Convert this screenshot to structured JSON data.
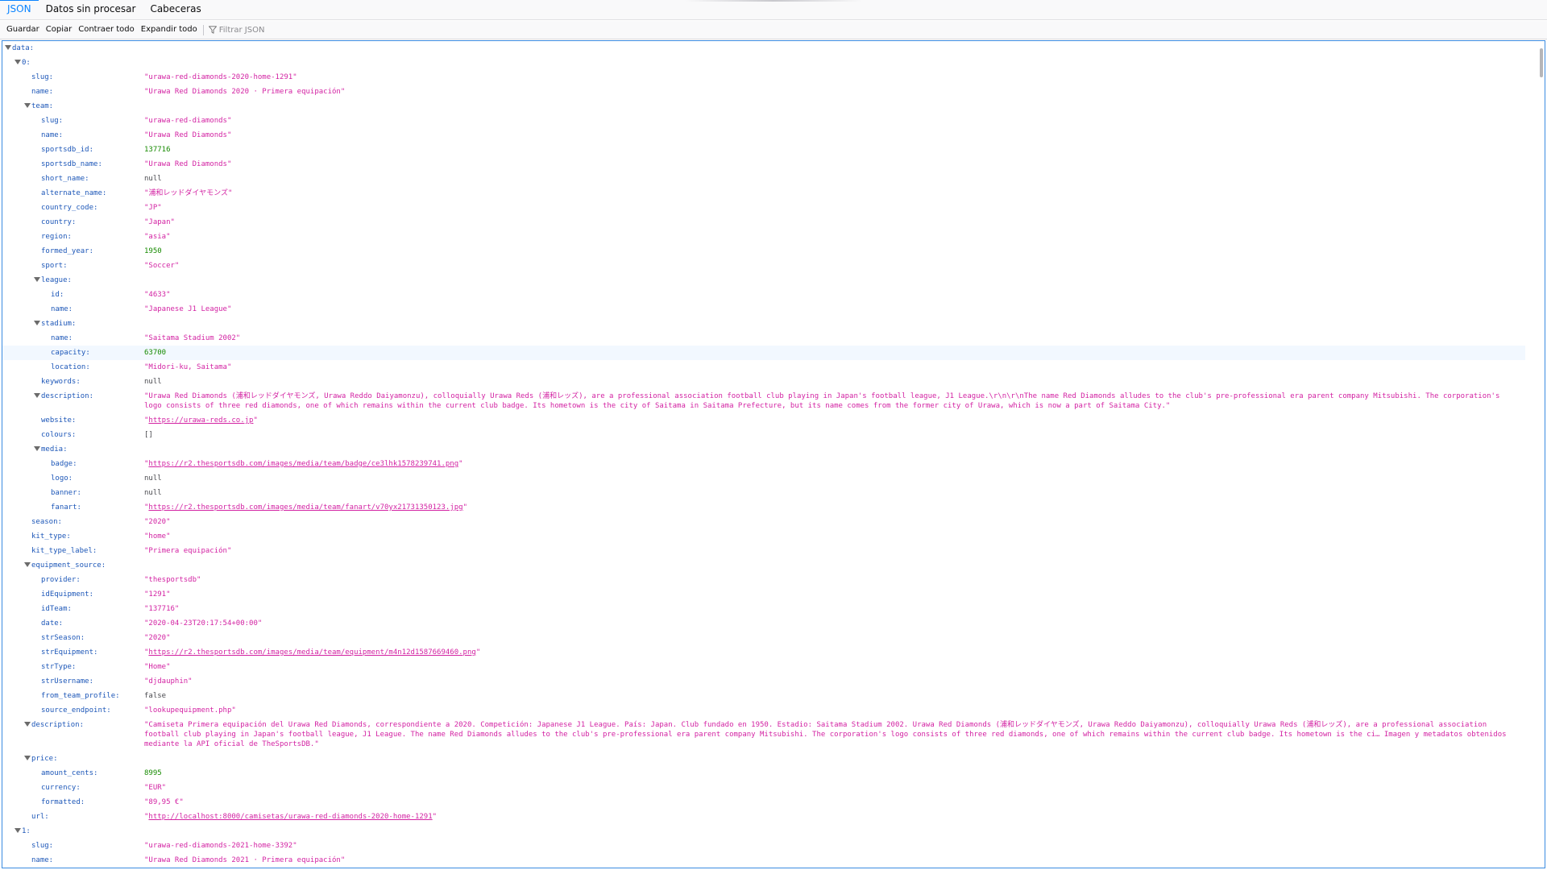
{
  "tabs": [
    {
      "label": "JSON"
    },
    {
      "label": "Datos sin procesar"
    },
    {
      "label": "Cabeceras"
    }
  ],
  "toolbar": {
    "save_label": "Guardar",
    "copy_label": "Copiar",
    "collapse_label": "Contraer todo",
    "expand_label": "Expandir todo",
    "filter_placeholder": "Filtrar JSON"
  },
  "icons": {
    "twisty": "expanded-triangle-icon",
    "filter": "funnel-icon"
  },
  "colors": {
    "accent": "#0a84ff",
    "key": "#1d57b8",
    "string": "#d323a3",
    "number": "#168a00",
    "highlight_row": "#f2f8ff"
  },
  "rows": [
    {
      "depth": 0,
      "toggle": true,
      "key": "data:",
      "type": "obj"
    },
    {
      "depth": 1,
      "toggle": true,
      "key": "0:",
      "type": "obj"
    },
    {
      "depth": 2,
      "key": "slug:",
      "value": "\"urawa-red-diamonds-2020-home-1291\"",
      "type": "str"
    },
    {
      "depth": 2,
      "key": "name:",
      "value": "\"Urawa Red Diamonds 2020 · Primera equipación\"",
      "type": "str"
    },
    {
      "depth": 2,
      "toggle": true,
      "key": "team:",
      "type": "obj"
    },
    {
      "depth": 3,
      "key": "slug:",
      "value": "\"urawa-red-diamonds\"",
      "type": "str"
    },
    {
      "depth": 3,
      "key": "name:",
      "value": "\"Urawa Red Diamonds\"",
      "type": "str"
    },
    {
      "depth": 3,
      "key": "sportsdb_id:",
      "value": "137716",
      "type": "num"
    },
    {
      "depth": 3,
      "key": "sportsdb_name:",
      "value": "\"Urawa Red Diamonds\"",
      "type": "str"
    },
    {
      "depth": 3,
      "key": "short_name:",
      "value": "null",
      "type": "nul"
    },
    {
      "depth": 3,
      "key": "alternate_name:",
      "value": "\"浦和レッドダイヤモンズ\"",
      "type": "str"
    },
    {
      "depth": 3,
      "key": "country_code:",
      "value": "\"JP\"",
      "type": "str"
    },
    {
      "depth": 3,
      "key": "country:",
      "value": "\"Japan\"",
      "type": "str"
    },
    {
      "depth": 3,
      "key": "region:",
      "value": "\"asia\"",
      "type": "str"
    },
    {
      "depth": 3,
      "key": "formed_year:",
      "value": "1950",
      "type": "num"
    },
    {
      "depth": 3,
      "key": "sport:",
      "value": "\"Soccer\"",
      "type": "str"
    },
    {
      "depth": 3,
      "toggle": true,
      "key": "league:",
      "type": "obj"
    },
    {
      "depth": 4,
      "key": "id:",
      "value": "\"4633\"",
      "type": "str"
    },
    {
      "depth": 4,
      "key": "name:",
      "value": "\"Japanese J1 League\"",
      "type": "str"
    },
    {
      "depth": 3,
      "toggle": true,
      "key": "stadium:",
      "type": "obj"
    },
    {
      "depth": 4,
      "key": "name:",
      "value": "\"Saitama Stadium 2002\"",
      "type": "str"
    },
    {
      "depth": 4,
      "key": "capacity:",
      "value": "63700",
      "type": "num",
      "highlight": true
    },
    {
      "depth": 4,
      "key": "location:",
      "value": "\"Midori-ku, Saitama\"",
      "type": "str"
    },
    {
      "depth": 3,
      "key": "keywords:",
      "value": "null",
      "type": "nul"
    },
    {
      "depth": 3,
      "toggle": true,
      "key": "description:",
      "value": "\"Urawa Red Diamonds (浦和レッドダイヤモンズ, Urawa Reddo Daiyamonzu), colloquially Urawa Reds (浦和レッズ), are a professional association football club playing in Japan's football league, J1 League.\\r\\n\\r\\nThe name Red Diamonds alludes to the club's pre-professional era parent company Mitsubishi. The corporation's logo consists of three red diamonds, one of which remains within the current club badge. Its hometown is the city of Saitama in Saitama Prefecture, but its name comes from the former city of Urawa, which is now a part of Saitama City.\"",
      "type": "str",
      "lines": 2
    },
    {
      "depth": 3,
      "key": "website:",
      "value": "https://urawa-reds.co.jp",
      "type": "link"
    },
    {
      "depth": 3,
      "key": "colours:",
      "value": "[]",
      "type": "arr"
    },
    {
      "depth": 3,
      "toggle": true,
      "key": "media:",
      "type": "obj"
    },
    {
      "depth": 4,
      "key": "badge:",
      "value": "https://r2.thesportsdb.com/images/media/team/badge/ce3lhk1578239741.png",
      "type": "link"
    },
    {
      "depth": 4,
      "key": "logo:",
      "value": "null",
      "type": "nul"
    },
    {
      "depth": 4,
      "key": "banner:",
      "value": "null",
      "type": "nul"
    },
    {
      "depth": 4,
      "key": "fanart:",
      "value": "https://r2.thesportsdb.com/images/media/team/fanart/v70yx21731350123.jpg",
      "type": "link"
    },
    {
      "depth": 2,
      "key": "season:",
      "value": "\"2020\"",
      "type": "str"
    },
    {
      "depth": 2,
      "key": "kit_type:",
      "value": "\"home\"",
      "type": "str"
    },
    {
      "depth": 2,
      "key": "kit_type_label:",
      "value": "\"Primera equipación\"",
      "type": "str"
    },
    {
      "depth": 2,
      "toggle": true,
      "key": "equipment_source:",
      "type": "obj"
    },
    {
      "depth": 3,
      "key": "provider:",
      "value": "\"thesportsdb\"",
      "type": "str"
    },
    {
      "depth": 3,
      "key": "idEquipment:",
      "value": "\"1291\"",
      "type": "str"
    },
    {
      "depth": 3,
      "key": "idTeam:",
      "value": "\"137716\"",
      "type": "str"
    },
    {
      "depth": 3,
      "key": "date:",
      "value": "\"2020-04-23T20:17:54+00:00\"",
      "type": "str"
    },
    {
      "depth": 3,
      "key": "strSeason:",
      "value": "\"2020\"",
      "type": "str"
    },
    {
      "depth": 3,
      "key": "strEquipment:",
      "value": "https://r2.thesportsdb.com/images/media/team/equipment/m4n12d1587669460.png",
      "type": "link"
    },
    {
      "depth": 3,
      "key": "strType:",
      "value": "\"Home\"",
      "type": "str"
    },
    {
      "depth": 3,
      "key": "strUsername:",
      "value": "\"djdauphin\"",
      "type": "str"
    },
    {
      "depth": 3,
      "key": "from_team_profile:",
      "value": "false",
      "type": "bool"
    },
    {
      "depth": 3,
      "key": "source_endpoint:",
      "value": "\"lookupequipment.php\"",
      "type": "str"
    },
    {
      "depth": 2,
      "toggle": true,
      "key": "description:",
      "value": "\"Camiseta Primera equipación del Urawa Red Diamonds, correspondiente a 2020. Competición: Japanese J1 League. País: Japan. Club fundado en 1950. Estadio: Saitama Stadium 2002. Urawa Red Diamonds (浦和レッドダイヤモンズ, Urawa Reddo Daiyamonzu), colloquially Urawa Reds (浦和レッズ), are a professional association football club playing in Japan's football league, J1 League. The name Red Diamonds alludes to the club's pre-professional era parent company Mitsubishi. The corporation's logo consists of three red diamonds, one of which remains within the current club badge. Its hometown is the ci… Imagen y metadatos obtenidos mediante la API oficial de TheSportsDB.\"",
      "type": "str",
      "lines": 3
    },
    {
      "depth": 2,
      "toggle": true,
      "key": "price:",
      "type": "obj"
    },
    {
      "depth": 3,
      "key": "amount_cents:",
      "value": "8995",
      "type": "num"
    },
    {
      "depth": 3,
      "key": "currency:",
      "value": "\"EUR\"",
      "type": "str"
    },
    {
      "depth": 3,
      "key": "formatted:",
      "value": "\"89,95 €\"",
      "type": "str"
    },
    {
      "depth": 2,
      "key": "url:",
      "value": "http://localhost:8000/camisetas/urawa-red-diamonds-2020-home-1291",
      "type": "link"
    },
    {
      "depth": 1,
      "toggle": true,
      "key": "1:",
      "type": "obj"
    },
    {
      "depth": 2,
      "key": "slug:",
      "value": "\"urawa-red-diamonds-2021-home-3392\"",
      "type": "str"
    },
    {
      "depth": 2,
      "key": "name:",
      "value": "\"Urawa Red Diamonds 2021 · Primera equipación\"",
      "type": "str"
    }
  ]
}
